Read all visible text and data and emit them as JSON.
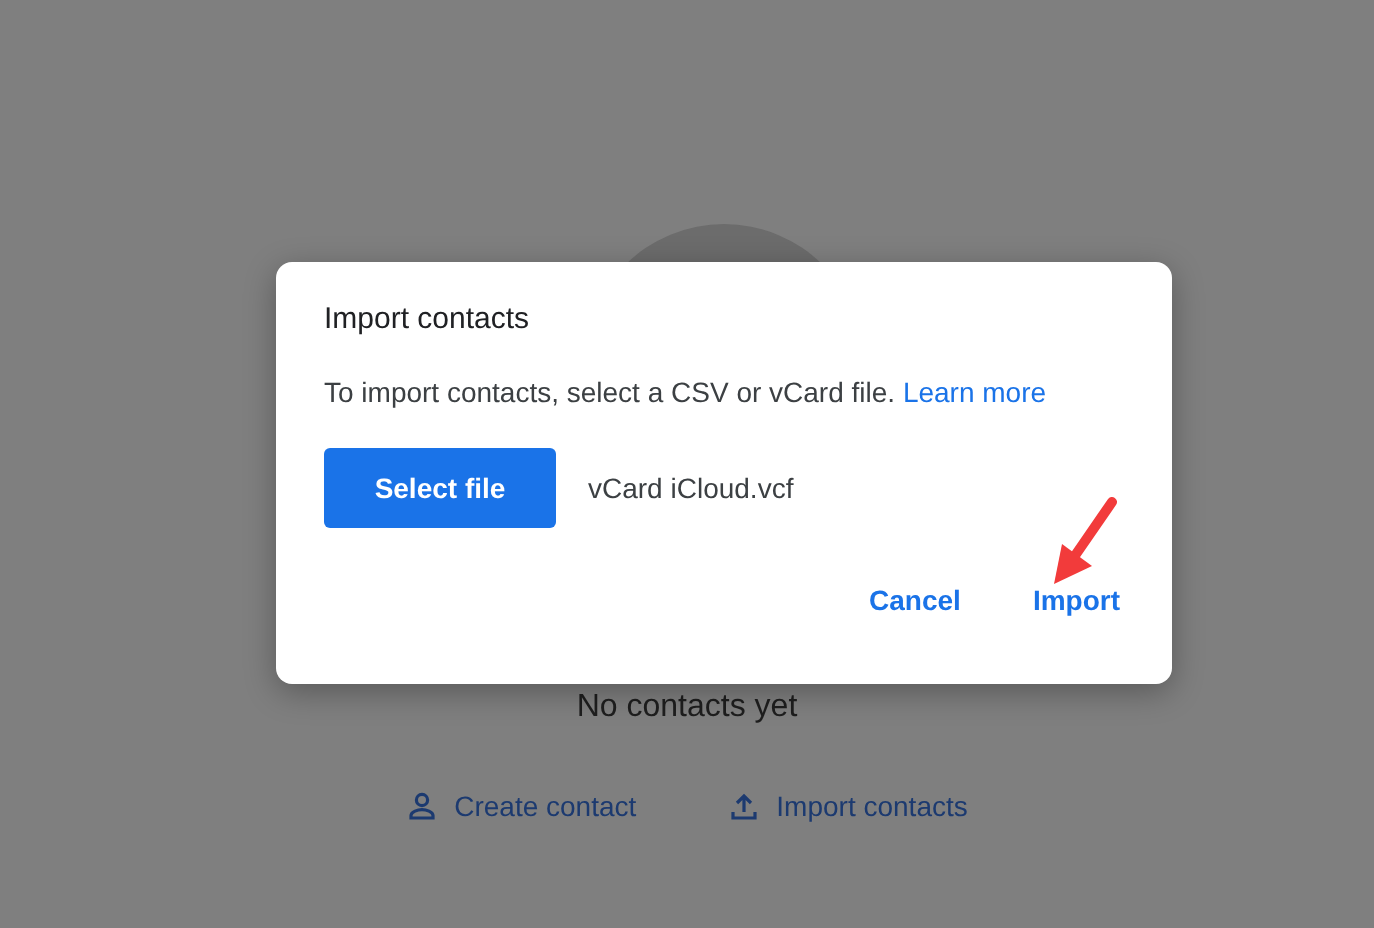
{
  "background": {
    "empty_message": "No contacts yet",
    "actions": [
      {
        "label": "Create contact",
        "kind": "person"
      },
      {
        "label": "Import contacts",
        "kind": "upload"
      }
    ]
  },
  "dialog": {
    "title": "Import contacts",
    "description": "To import contacts, select a CSV or vCard file.",
    "link": "Learn more",
    "select_button": "Select file",
    "file_name": "vCard iCloud.vcf",
    "buttons": [
      "Cancel",
      "Import"
    ]
  },
  "annotation": {
    "kind": "arrow"
  }
}
